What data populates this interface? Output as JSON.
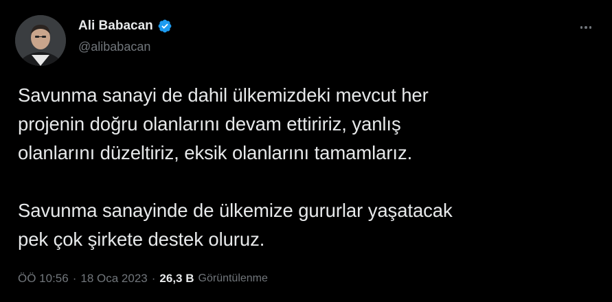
{
  "author": {
    "display_name": "Ali Babacan",
    "handle": "@alibabacan",
    "verified_icon": "verified-badge-icon"
  },
  "colors": {
    "background": "#000000",
    "primary_text": "#e7e9ea",
    "secondary_text": "#71767b",
    "verified": "#1d9bf0"
  },
  "tweet": {
    "paragraph_1": "Savunma sanayi de dahil ülkemizdeki mevcut her\nprojenin doğru olanlarını devam ettiririz, yanlış\nolanlarını düzeltiriz, eksik olanlarını tamamlarız.",
    "paragraph_2": "Savunma sanayinde de ülkemize gururlar yaşatacak\npek çok şirkete destek oluruz."
  },
  "meta": {
    "time": "ÖÖ 10:56",
    "separator": "·",
    "date": "18 Oca 2023",
    "views_count": "26,3 B",
    "views_label": "Görüntülenme"
  },
  "more_icon": "more-dots-icon"
}
